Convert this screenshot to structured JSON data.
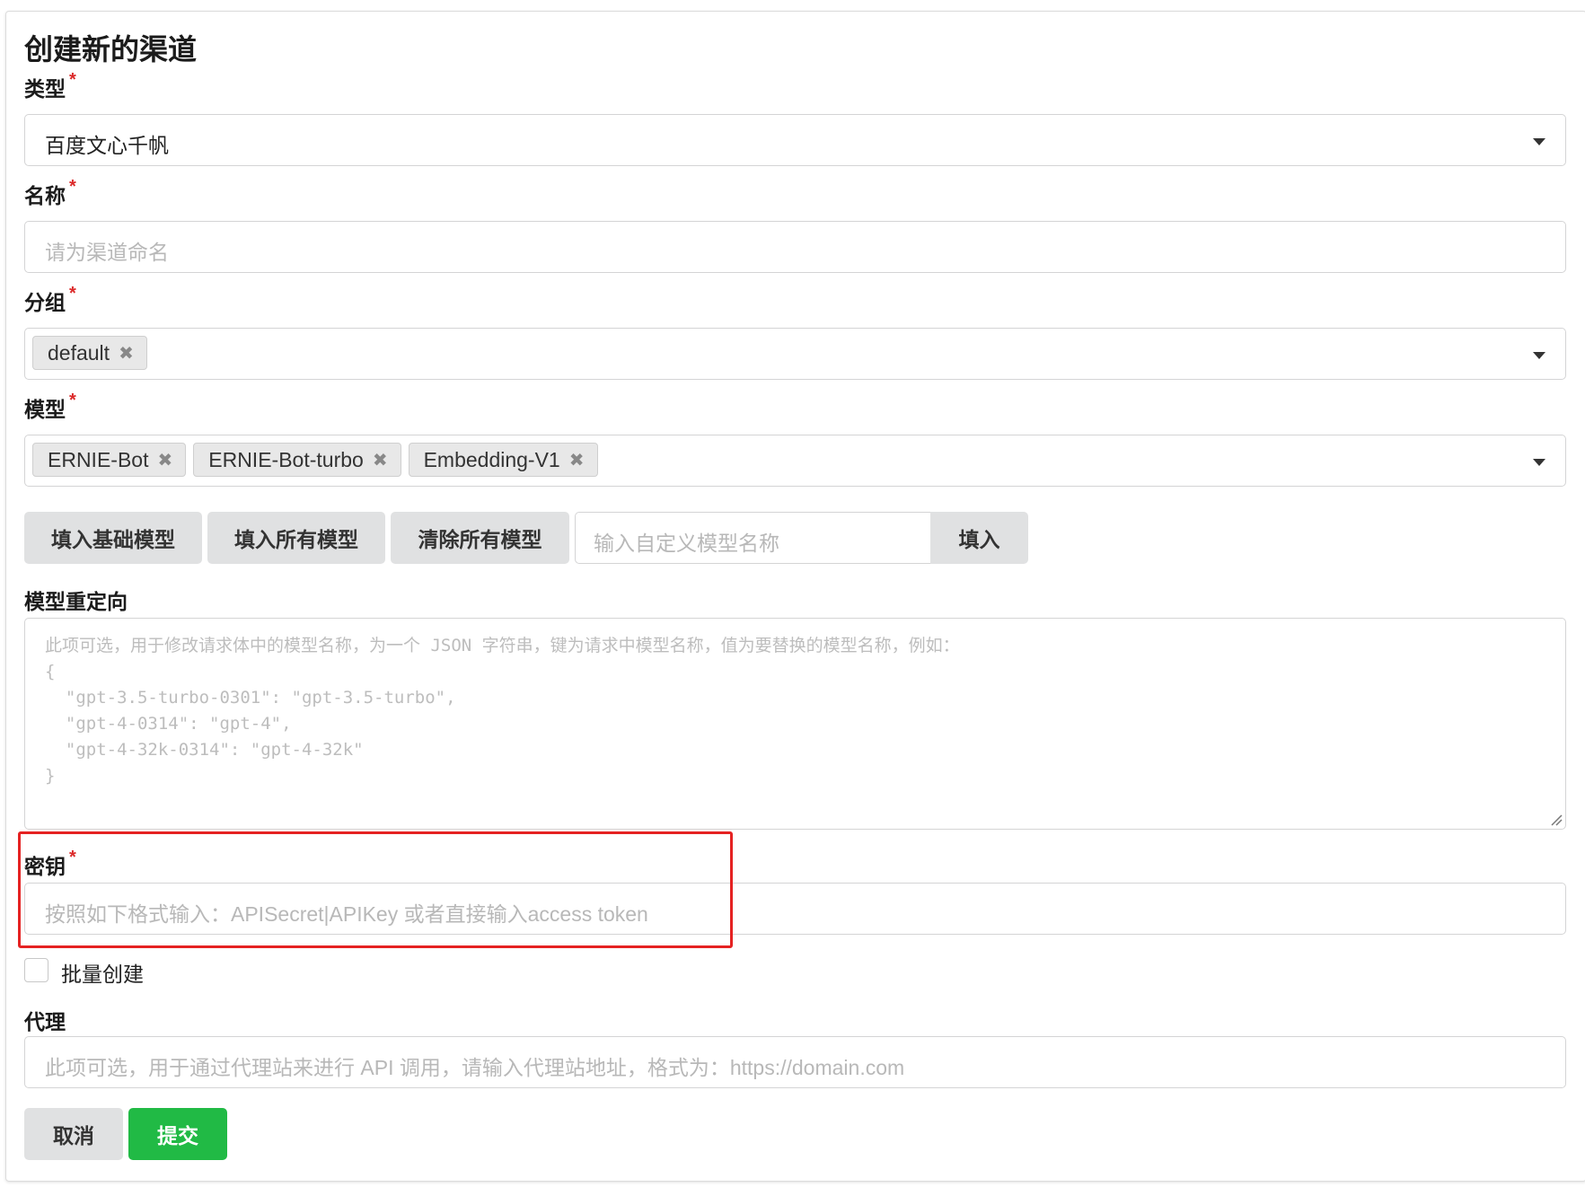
{
  "page": {
    "title": "创建新的渠道"
  },
  "form": {
    "type": {
      "label": "类型",
      "required_mark": "*",
      "value": "百度文心千帆"
    },
    "name": {
      "label": "名称",
      "required_mark": "*",
      "placeholder": "请为渠道命名"
    },
    "group": {
      "label": "分组",
      "required_mark": "*",
      "chips": [
        "default"
      ]
    },
    "models": {
      "label": "模型",
      "required_mark": "*",
      "chips": [
        "ERNIE-Bot",
        "ERNIE-Bot-turbo",
        "Embedding-V1"
      ],
      "fill_basic_label": "填入基础模型",
      "fill_all_label": "填入所有模型",
      "clear_all_label": "清除所有模型",
      "custom_placeholder": "输入自定义模型名称",
      "custom_fill_label": "填入"
    },
    "model_mapping": {
      "label": "模型重定向",
      "placeholder": "此项可选，用于修改请求体中的模型名称，为一个 JSON 字符串，键为请求中模型名称，值为要替换的模型名称，例如：\n{\n  \"gpt-3.5-turbo-0301\": \"gpt-3.5-turbo\",\n  \"gpt-4-0314\": \"gpt-4\",\n  \"gpt-4-32k-0314\": \"gpt-4-32k\"\n}"
    },
    "key": {
      "label": "密钥",
      "required_mark": "*",
      "placeholder": "按照如下格式输入：APISecret|APIKey 或者直接输入access token"
    },
    "batch": {
      "label": "批量创建",
      "checked": false
    },
    "proxy": {
      "label": "代理",
      "placeholder": "此项可选，用于通过代理站来进行 API 调用，请输入代理站地址，格式为：https://domain.com"
    },
    "actions": {
      "cancel_label": "取消",
      "submit_label": "提交"
    }
  },
  "colors": {
    "submit": "#21ba45",
    "required": "#db2828",
    "highlight": "#e52222"
  },
  "icons": {
    "dropdown": "caret-down-icon",
    "chip_remove": "close-icon",
    "resize": "resize-handle-icon"
  }
}
